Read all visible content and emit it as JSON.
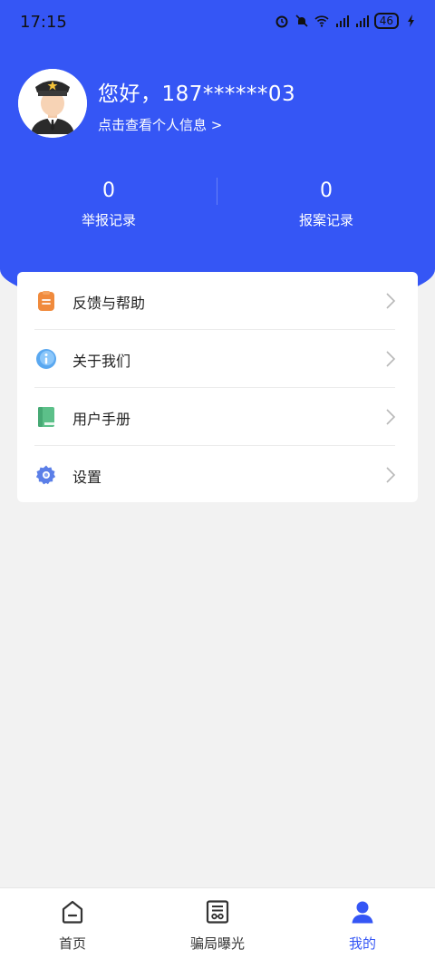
{
  "status_bar": {
    "time": "17:15",
    "battery": "46"
  },
  "profile": {
    "greeting": "您好，187******03",
    "link_text": "点击查看个人信息 >"
  },
  "stats": [
    {
      "value": "0",
      "label": "举报记录"
    },
    {
      "value": "0",
      "label": "报案记录"
    }
  ],
  "menu": [
    {
      "label": "反馈与帮助",
      "icon": "feedback-clipboard-icon"
    },
    {
      "label": "关于我们",
      "icon": "info-bubble-icon"
    },
    {
      "label": "用户手册",
      "icon": "book-icon"
    },
    {
      "label": "设置",
      "icon": "gear-icon"
    }
  ],
  "tabs": [
    {
      "label": "首页",
      "icon": "home-icon",
      "active": false
    },
    {
      "label": "骗局曝光",
      "icon": "newspaper-icon",
      "active": false
    },
    {
      "label": "我的",
      "icon": "user-icon",
      "active": true
    }
  ],
  "colors": {
    "primary": "#3556f5",
    "background": "#f2f2f2"
  }
}
